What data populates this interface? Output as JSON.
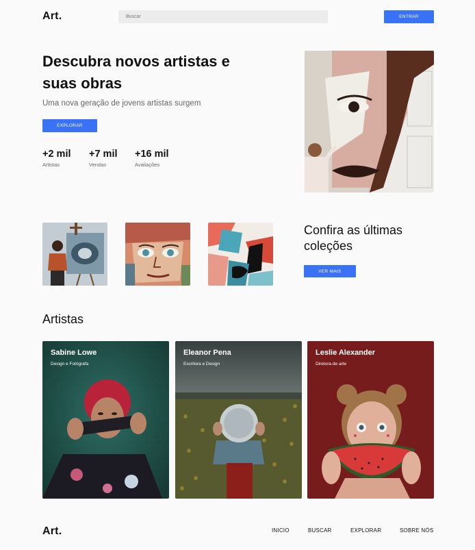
{
  "header": {
    "logo": "Art.",
    "search_placeholder": "Buscar",
    "login_label": "ENTRAR"
  },
  "hero": {
    "title": "Descubra novos artistas e suas obras",
    "subtitle": "Uma nova geração de jovens artistas surgem",
    "explore_label": "EXPLORAR",
    "stats": [
      {
        "value": "+2 mil",
        "label": "Artistas"
      },
      {
        "value": "+7 mil",
        "label": "Vendas"
      },
      {
        "value": "+16 mil",
        "label": "Avaliações"
      }
    ]
  },
  "collections": {
    "title": "Confira as últimas coleções",
    "cta_label": "VER MAIS"
  },
  "artists": {
    "title": "Artistas",
    "cards": [
      {
        "name": "Sabine Lowe",
        "role": "Design e Fotógrafa"
      },
      {
        "name": "Eleanor Pena",
        "role": "Escritora e Design"
      },
      {
        "name": "Leslie Alexander",
        "role": "Diretora de arte"
      }
    ]
  },
  "footer": {
    "logo": "Art.",
    "nav": [
      "INICIO",
      "BUSCAR",
      "EXPLORAR",
      "SOBRE NÓS"
    ]
  },
  "colors": {
    "accent": "#3a72f6",
    "background": "#fafafa"
  }
}
